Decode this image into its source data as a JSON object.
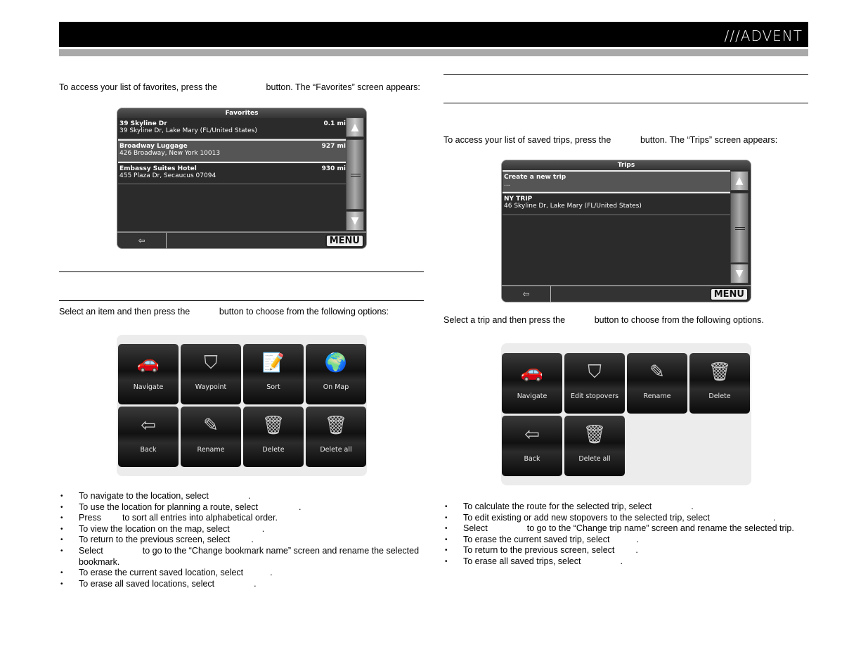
{
  "header": {
    "logo": "///ADVENT"
  },
  "left": {
    "intro": "To access your list of favorites, press the                    button. The “Favorites” screen appears:",
    "options_intro": "Select an item and then press the            button to choose from the following options:",
    "favorites_screen": {
      "title": "Favorites",
      "rows": [
        {
          "name": "39 Skyline Dr",
          "address": "39 Skyline Dr, Lake Mary (FL/United States)",
          "distance": "0.1 mi"
        },
        {
          "name": "Broadway Luggage",
          "address": "426 Broadway, New York 10013",
          "distance": "927 mi"
        },
        {
          "name": "Embassy Suites Hotel",
          "address": "455 Plaza Dr, Secaucus 07094",
          "distance": "930 mi"
        }
      ],
      "menu": "MENU"
    },
    "options_screen": {
      "tiles": [
        "Navigate",
        "Waypoint",
        "Sort",
        "On Map",
        "Back",
        "Rename",
        "Delete",
        "Delete all"
      ]
    },
    "bullets": [
      {
        "a": "To navigate to the location, select",
        "b": "."
      },
      {
        "a": "To use the location for planning a route, select",
        "b": "."
      },
      {
        "a": "Press",
        "b": "to sort all entries into alphabetical order."
      },
      {
        "a": "To view the location on the map, select",
        "b": "."
      },
      {
        "a": "To return to the previous screen, select",
        "b": "."
      },
      {
        "a": "Select",
        "b": "to go to the “Change bookmark name” screen and rename the selected bookmark."
      },
      {
        "a": "To erase the current saved location, select",
        "b": "."
      },
      {
        "a": "To erase all saved locations, select",
        "b": "."
      }
    ]
  },
  "right": {
    "intro": "To access your list of saved trips, press the            button. The “Trips” screen appears:",
    "options_intro": "Select a trip and then press the            button to choose from the following options.",
    "trips_screen": {
      "title": "Trips",
      "rows": [
        {
          "name": "Create a new trip",
          "address": "...",
          "distance": ""
        },
        {
          "name": "NY TRIP",
          "address": "46 Skyline Dr, Lake Mary (FL/United States)",
          "distance": ""
        }
      ],
      "menu": "MENU"
    },
    "options_screen": {
      "tiles": [
        "Navigate",
        "Edit stopovers",
        "Rename",
        "Delete",
        "Back",
        "Delete all"
      ]
    },
    "bullets": [
      {
        "a": "To calculate the route for the selected trip, select",
        "b": "."
      },
      {
        "a": "To edit existing or add new stopovers to the selected trip, select",
        "b": "."
      },
      {
        "a": "Select",
        "b": "to go to the “Change trip name” screen and rename the selected trip."
      },
      {
        "a": "To erase the current saved trip, select",
        "b": "."
      },
      {
        "a": "To return to the previous screen, select",
        "b": "."
      },
      {
        "a": "To erase all saved trips, select",
        "b": "."
      }
    ]
  }
}
